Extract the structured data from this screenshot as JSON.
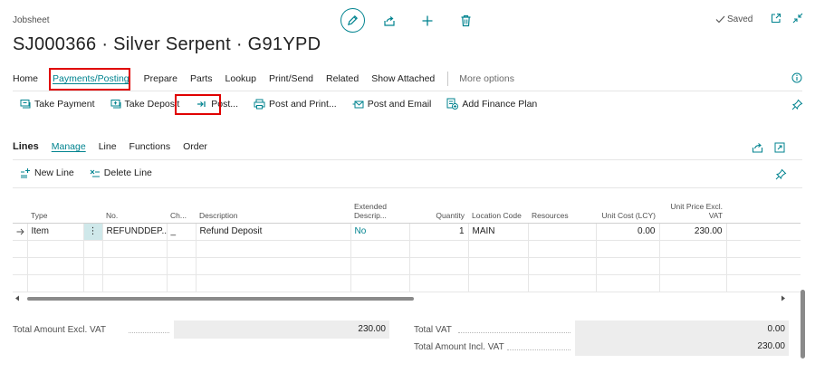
{
  "page": {
    "breadcrumb": "Jobsheet",
    "title": "SJ000366 · Silver Serpent · G91YPD",
    "saved_label": "Saved"
  },
  "menu": {
    "items": [
      "Home",
      "Payments/Posting",
      "Prepare",
      "Parts",
      "Lookup",
      "Print/Send",
      "Related",
      "Show Attached"
    ],
    "active": "Payments/Posting",
    "more": "More options"
  },
  "actions": {
    "take_payment": "Take Payment",
    "take_deposit": "Take Deposit",
    "post": "Post...",
    "post_and_print": "Post and Print...",
    "post_and_email": "Post and Email",
    "add_finance_plan": "Add Finance Plan"
  },
  "lines": {
    "title": "Lines",
    "menu": [
      "Manage",
      "Line",
      "Functions",
      "Order"
    ],
    "active": "Manage",
    "new_line": "New Line",
    "delete_line": "Delete Line",
    "columns": {
      "type": "Type",
      "no": "No.",
      "ch": "Ch...",
      "description": "Description",
      "extended": "Extended Descrip...",
      "quantity": "Quantity",
      "location": "Location Code",
      "resources": "Resources",
      "unit_cost": "Unit Cost (LCY)",
      "unit_price": "Unit Price Excl. VAT"
    },
    "rows": [
      {
        "type": "Item",
        "no": "REFUNDDEP...",
        "ch": "_",
        "description": "Refund Deposit",
        "extended": "No",
        "quantity": "1",
        "location": "MAIN",
        "resources": "",
        "unit_cost": "0.00",
        "unit_price": "230.00"
      }
    ]
  },
  "totals": {
    "excl_vat_label": "Total Amount Excl. VAT",
    "excl_vat_value": "230.00",
    "vat_label": "Total VAT",
    "vat_value": "0.00",
    "incl_vat_label": "Total Amount Incl. VAT",
    "incl_vat_value": "230.00"
  },
  "colors": {
    "accent": "#00838f",
    "highlight_border": "#e00000",
    "selected_cell": "#cfe8ea"
  }
}
